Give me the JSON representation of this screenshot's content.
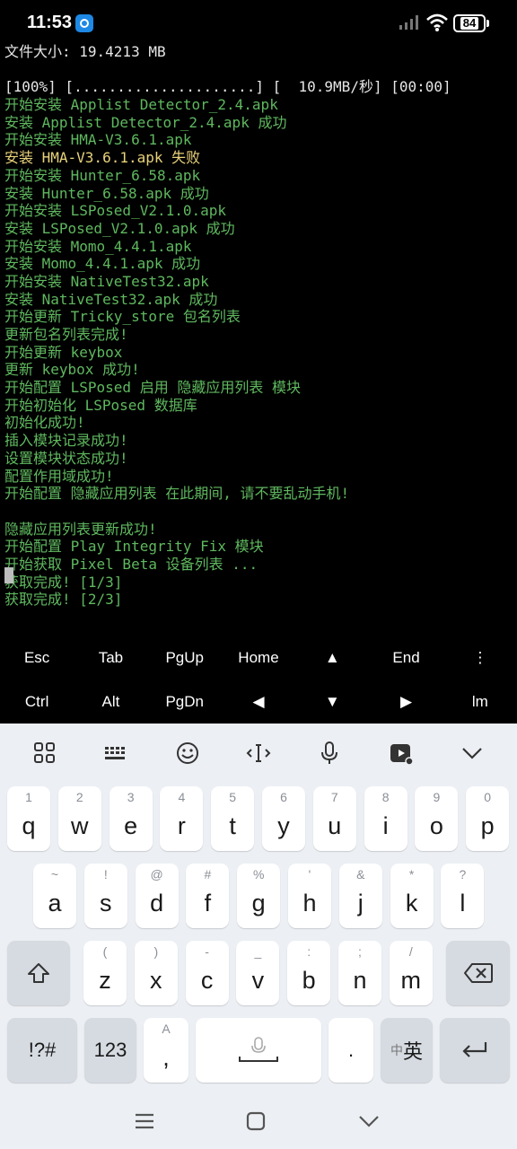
{
  "status_bar": {
    "time": "11:53",
    "battery": "84"
  },
  "terminal": {
    "lines": [
      {
        "text": "文件大小: 19.4213 MB",
        "color": "white"
      },
      {
        "text": "",
        "color": "white"
      },
      {
        "text": "[100%] [.....................] [  10.9MB/秒] [00:00]",
        "color": "white"
      },
      {
        "text": "开始安装 Applist Detector_2.4.apk",
        "color": "green"
      },
      {
        "text": "安装 Applist Detector_2.4.apk 成功",
        "color": "green"
      },
      {
        "text": "开始安装 HMA-V3.6.1.apk",
        "color": "green"
      },
      {
        "text": "安装 HMA-V3.6.1.apk 失败",
        "color": "yellow"
      },
      {
        "text": "开始安装 Hunter_6.58.apk",
        "color": "green"
      },
      {
        "text": "安装 Hunter_6.58.apk 成功",
        "color": "green"
      },
      {
        "text": "开始安装 LSPosed_V2.1.0.apk",
        "color": "green"
      },
      {
        "text": "安装 LSPosed_V2.1.0.apk 成功",
        "color": "green"
      },
      {
        "text": "开始安装 Momo_4.4.1.apk",
        "color": "green"
      },
      {
        "text": "安装 Momo_4.4.1.apk 成功",
        "color": "green"
      },
      {
        "text": "开始安装 NativeTest32.apk",
        "color": "green"
      },
      {
        "text": "安装 NativeTest32.apk 成功",
        "color": "green"
      },
      {
        "text": "开始更新 Tricky_store 包名列表",
        "color": "green"
      },
      {
        "text": "更新包名列表完成!",
        "color": "green"
      },
      {
        "text": "开始更新 keybox",
        "color": "green"
      },
      {
        "text": "更新 keybox 成功!",
        "color": "green"
      },
      {
        "text": "开始配置 LSPosed 启用 隐藏应用列表 模块",
        "color": "green"
      },
      {
        "text": "开始初始化 LSPosed 数据库",
        "color": "green"
      },
      {
        "text": "初始化成功!",
        "color": "green"
      },
      {
        "text": "插入模块记录成功!",
        "color": "green"
      },
      {
        "text": "设置模块状态成功!",
        "color": "green"
      },
      {
        "text": "配置作用域成功!",
        "color": "green"
      },
      {
        "text": "开始配置 隐藏应用列表 在此期间, 请不要乱动手机!",
        "color": "green"
      },
      {
        "text": "",
        "color": "green"
      },
      {
        "text": "隐藏应用列表更新成功!",
        "color": "green"
      },
      {
        "text": "开始配置 Play Integrity Fix 模块",
        "color": "green"
      },
      {
        "text": "开始获取 Pixel Beta 设备列表 ...",
        "color": "green"
      },
      {
        "text": "获取完成! [1/3]",
        "color": "green"
      },
      {
        "text": "获取完成! [2/3]",
        "color": "green"
      }
    ]
  },
  "extra_keys": {
    "row1": [
      "Esc",
      "Tab",
      "PgUp",
      "Home",
      "▲",
      "End",
      "⋮"
    ],
    "row2": [
      "Ctrl",
      "Alt",
      "PgDn",
      "◀",
      "▼",
      "▶",
      "lm"
    ]
  },
  "keyboard": {
    "row1": [
      {
        "k": "q",
        "h": "1"
      },
      {
        "k": "w",
        "h": "2"
      },
      {
        "k": "e",
        "h": "3"
      },
      {
        "k": "r",
        "h": "4"
      },
      {
        "k": "t",
        "h": "5"
      },
      {
        "k": "y",
        "h": "6"
      },
      {
        "k": "u",
        "h": "7"
      },
      {
        "k": "i",
        "h": "8"
      },
      {
        "k": "o",
        "h": "9"
      },
      {
        "k": "p",
        "h": "0"
      }
    ],
    "row2": [
      {
        "k": "a",
        "h": "~"
      },
      {
        "k": "s",
        "h": "!"
      },
      {
        "k": "d",
        "h": "@"
      },
      {
        "k": "f",
        "h": "#"
      },
      {
        "k": "g",
        "h": "%"
      },
      {
        "k": "h",
        "h": "'"
      },
      {
        "k": "j",
        "h": "&"
      },
      {
        "k": "k",
        "h": "*"
      },
      {
        "k": "l",
        "h": "?"
      }
    ],
    "row3": [
      {
        "k": "z",
        "h": "("
      },
      {
        "k": "x",
        "h": ")"
      },
      {
        "k": "c",
        "h": "-"
      },
      {
        "k": "v",
        "h": "_"
      },
      {
        "k": "b",
        "h": ":"
      },
      {
        "k": "n",
        "h": ";"
      },
      {
        "k": "m",
        "h": "/"
      }
    ],
    "symbols_label": "!?#",
    "numbers_label": "123",
    "comma_label": ",",
    "comma_hint": "A",
    "period_label": ".",
    "lang_small": "中",
    "lang_big": "英"
  }
}
